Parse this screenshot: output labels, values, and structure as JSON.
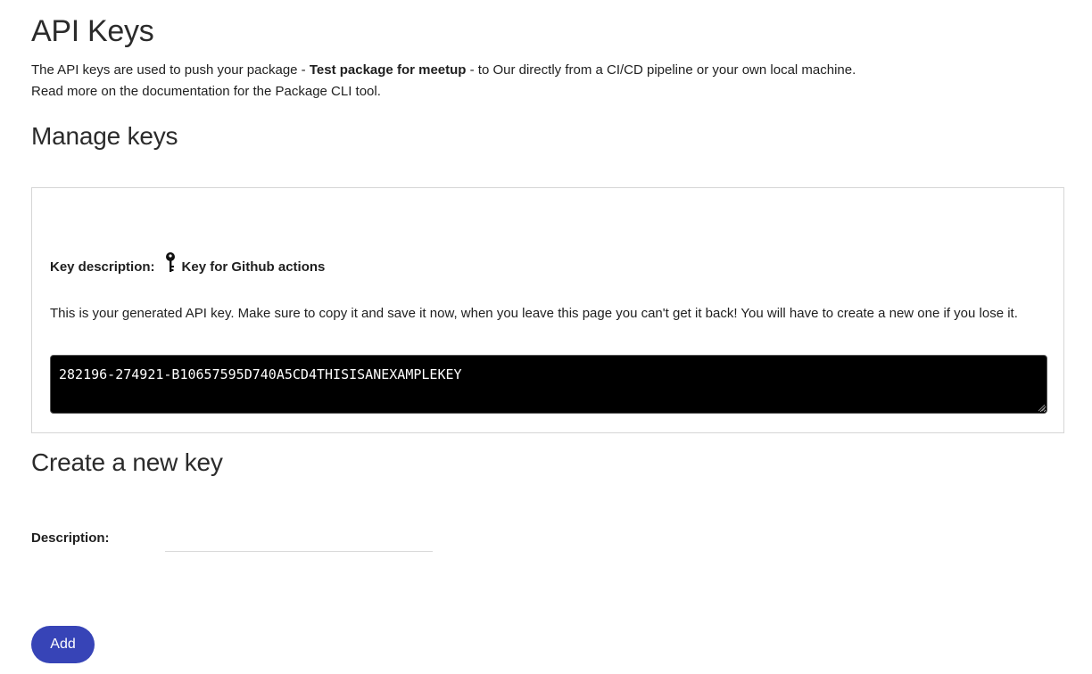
{
  "header": {
    "title": "API Keys"
  },
  "intro": {
    "line1_prefix": "The API keys are used to push your package - ",
    "package_name": "Test package for meetup",
    "line1_suffix": " - to Our directly from a CI/CD pipeline or your own local machine.",
    "line2": "Read more on the documentation for the Package CLI tool."
  },
  "manage": {
    "heading": "Manage keys",
    "key_description_label": "Key description:",
    "key_icon": "key-icon",
    "key_description_value": "Key for Github actions",
    "warning": "This is your generated API key. Make sure to copy it and save it now, when you leave this page you can't get it back! You will have to create a new one if you lose it.",
    "api_key": "282196-274921-B10657595D740A5CD4THISISANEXAMPLEKEY"
  },
  "create": {
    "heading": "Create a new key",
    "description_label": "Description:",
    "description_value": "",
    "add_label": "Add"
  },
  "colors": {
    "accent": "#3744b7",
    "key_box_bg": "#000000",
    "key_box_text": "#ffffff"
  }
}
